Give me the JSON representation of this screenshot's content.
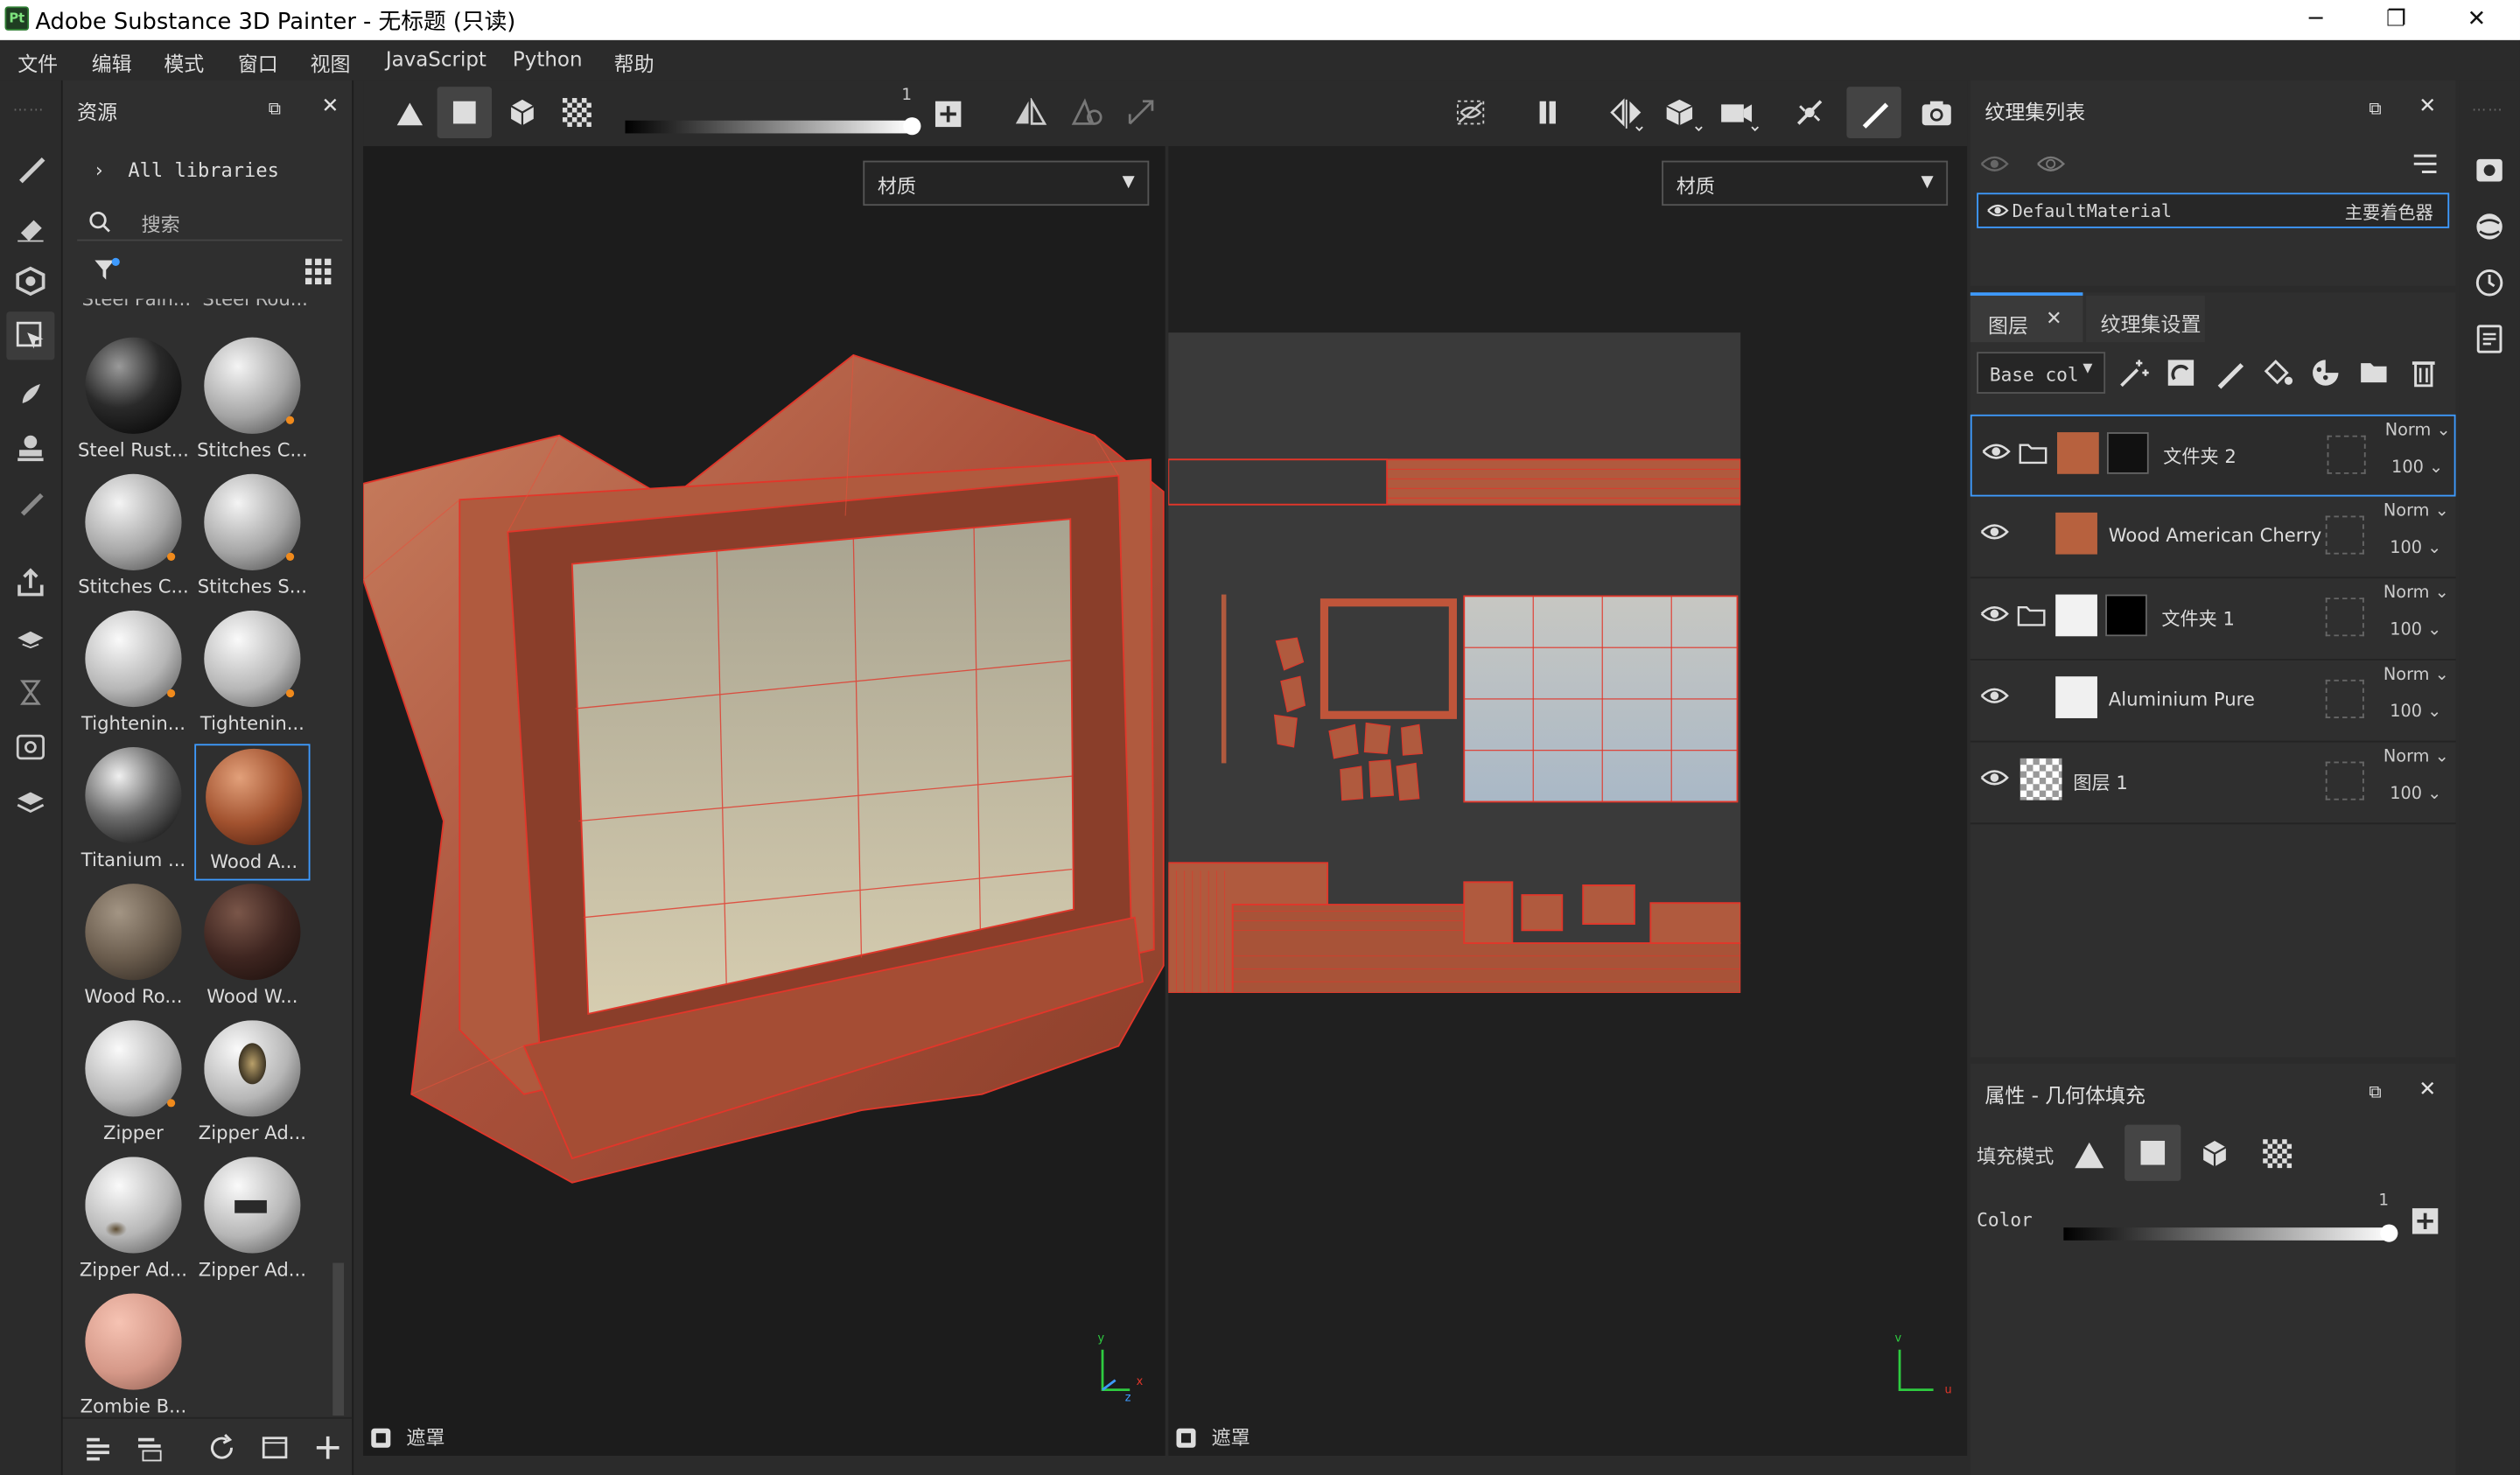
{
  "window": {
    "app_title": "Adobe Substance 3D Painter - 无标题 (只读)",
    "logo_text": "Pt",
    "minimize": "─",
    "restore": "❐",
    "close": "✕"
  },
  "menu": [
    "文件",
    "编辑",
    "模式",
    "窗口",
    "视图",
    "JavaScript",
    "Python",
    "帮助"
  ],
  "assets": {
    "title": "资源",
    "library": "All libraries",
    "search_placeholder": "搜索",
    "cut_labels": [
      "Steel Pain...",
      "Steel Rou..."
    ],
    "materials": [
      {
        "name": "Steel Rust...",
        "style": "steelrust",
        "dot": false
      },
      {
        "name": "Stitches C...",
        "style": "stitch1",
        "dot": true
      },
      {
        "name": "Stitches C...",
        "style": "stitch2",
        "dot": true
      },
      {
        "name": "Stitches S...",
        "style": "stitch3",
        "dot": true
      },
      {
        "name": "Tightenin...",
        "style": "white",
        "dot": true
      },
      {
        "name": "Tightenin...",
        "style": "tighten2",
        "dot": true
      },
      {
        "name": "Titanium ...",
        "style": "titanium",
        "dot": false
      },
      {
        "name": "Wood A...",
        "style": "woodam",
        "dot": false
      },
      {
        "name": "Wood Ro...",
        "style": "woodrough",
        "dot": false
      },
      {
        "name": "Wood W...",
        "style": "woodw",
        "dot": false
      },
      {
        "name": "Zipper",
        "style": "white",
        "dot": true
      },
      {
        "name": "Zipper Ad...",
        "style": "zipad1",
        "dot": false
      },
      {
        "name": "Zipper Ad...",
        "style": "zipad2",
        "dot": false
      },
      {
        "name": "Zipper Ad...",
        "style": "zipad3",
        "dot": false
      },
      {
        "name": "Zombie B...",
        "style": "zombie",
        "dot": false
      }
    ],
    "selected_index": 7
  },
  "toolbar": {
    "slider_value": "1"
  },
  "viewport": {
    "left_dropdown": "材质",
    "right_dropdown": "材质",
    "left_mask": "遮罩",
    "right_mask": "遮罩",
    "axis_x": "x",
    "axis_y": "y",
    "axis_z": "z",
    "axis_u": "u",
    "axis_v": "v"
  },
  "texture_set": {
    "title": "纹理集列表",
    "material": "DefaultMaterial",
    "shader": "主要着色器"
  },
  "layers": {
    "tab_layers": "图层",
    "tab_settings": "纹理集设置",
    "channel": "Base col",
    "items": [
      {
        "name": "文件夹 2",
        "blend": "Norm",
        "opacity": "100",
        "folder": true
      },
      {
        "name": "Wood American Cherry",
        "blend": "Norm",
        "opacity": "100",
        "folder": false
      },
      {
        "name": "文件夹 1",
        "blend": "Norm",
        "opacity": "100",
        "folder": true
      },
      {
        "name": "Aluminium Pure",
        "blend": "Norm",
        "opacity": "100",
        "folder": false
      },
      {
        "name": "图层 1",
        "blend": "Norm",
        "opacity": "100",
        "folder": false
      }
    ]
  },
  "properties": {
    "title": "属性 - 几何体填充",
    "fill_mode": "填充模式",
    "color_label": "Color",
    "color_value": "1"
  },
  "colors": {
    "accent": "#3e9bff",
    "wireframe": "#e2362a",
    "wood": "#b8583a"
  }
}
